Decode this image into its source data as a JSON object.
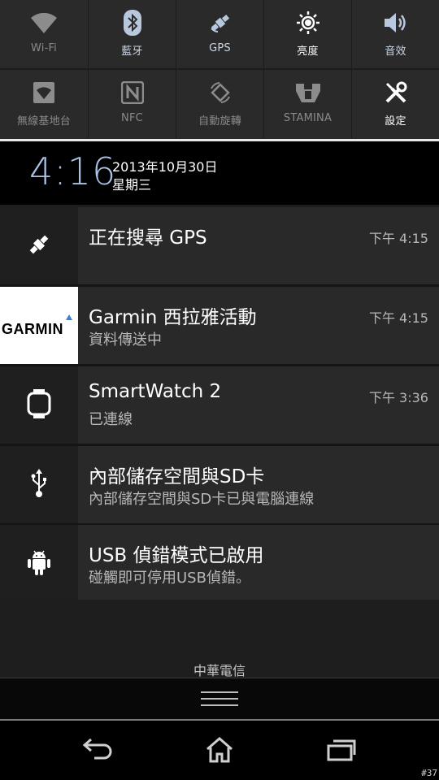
{
  "quick_settings": {
    "row1": [
      {
        "label": "Wi-Fi",
        "icon": "wifi-icon"
      },
      {
        "label": "藍牙",
        "icon": "bluetooth-icon"
      },
      {
        "label": "GPS",
        "icon": "gps-satellite-icon"
      },
      {
        "label": "亮度",
        "icon": "brightness-icon"
      },
      {
        "label": "音效",
        "icon": "volume-icon"
      }
    ],
    "row2": [
      {
        "label": "無線基地台",
        "icon": "hotspot-icon"
      },
      {
        "label": "NFC",
        "icon": "nfc-icon"
      },
      {
        "label": "自動旋轉",
        "icon": "auto-rotate-icon"
      },
      {
        "label": "STAMINA",
        "icon": "stamina-icon"
      },
      {
        "label": "設定",
        "icon": "settings-tools-icon"
      }
    ]
  },
  "clock": {
    "time": "4:16",
    "date": "2013年10月30日",
    "weekday": "星期三"
  },
  "notifications": [
    {
      "title": "正在搜尋 GPS",
      "subtitle": "",
      "time": "下午 4:15",
      "icon": "gps-satellite-icon"
    },
    {
      "title": "Garmin 西拉雅活動",
      "subtitle": "資料傳送中",
      "time": "下午 4:15",
      "icon": "garmin-logo",
      "logo_text": "GARMIN"
    },
    {
      "title": "SmartWatch 2",
      "subtitle": "已連線",
      "time": "下午 3:36",
      "icon": "smartwatch-icon"
    },
    {
      "title": "內部儲存空間與SD卡",
      "subtitle": "內部儲存空間與SD卡已與電腦連線",
      "time": "",
      "icon": "usb-icon"
    },
    {
      "title": "USB 偵錯模式已啟用",
      "subtitle": "碰觸即可停用USB偵錯。",
      "time": "",
      "icon": "android-icon"
    }
  ],
  "carrier": "中華電信",
  "navigation": {
    "back": "back-icon",
    "home": "home-icon",
    "recents": "recents-icon"
  },
  "corner_label": "#37",
  "colors": {
    "clock_time": "#a9c3e6",
    "garmin_accent": "#3a7fd8"
  }
}
